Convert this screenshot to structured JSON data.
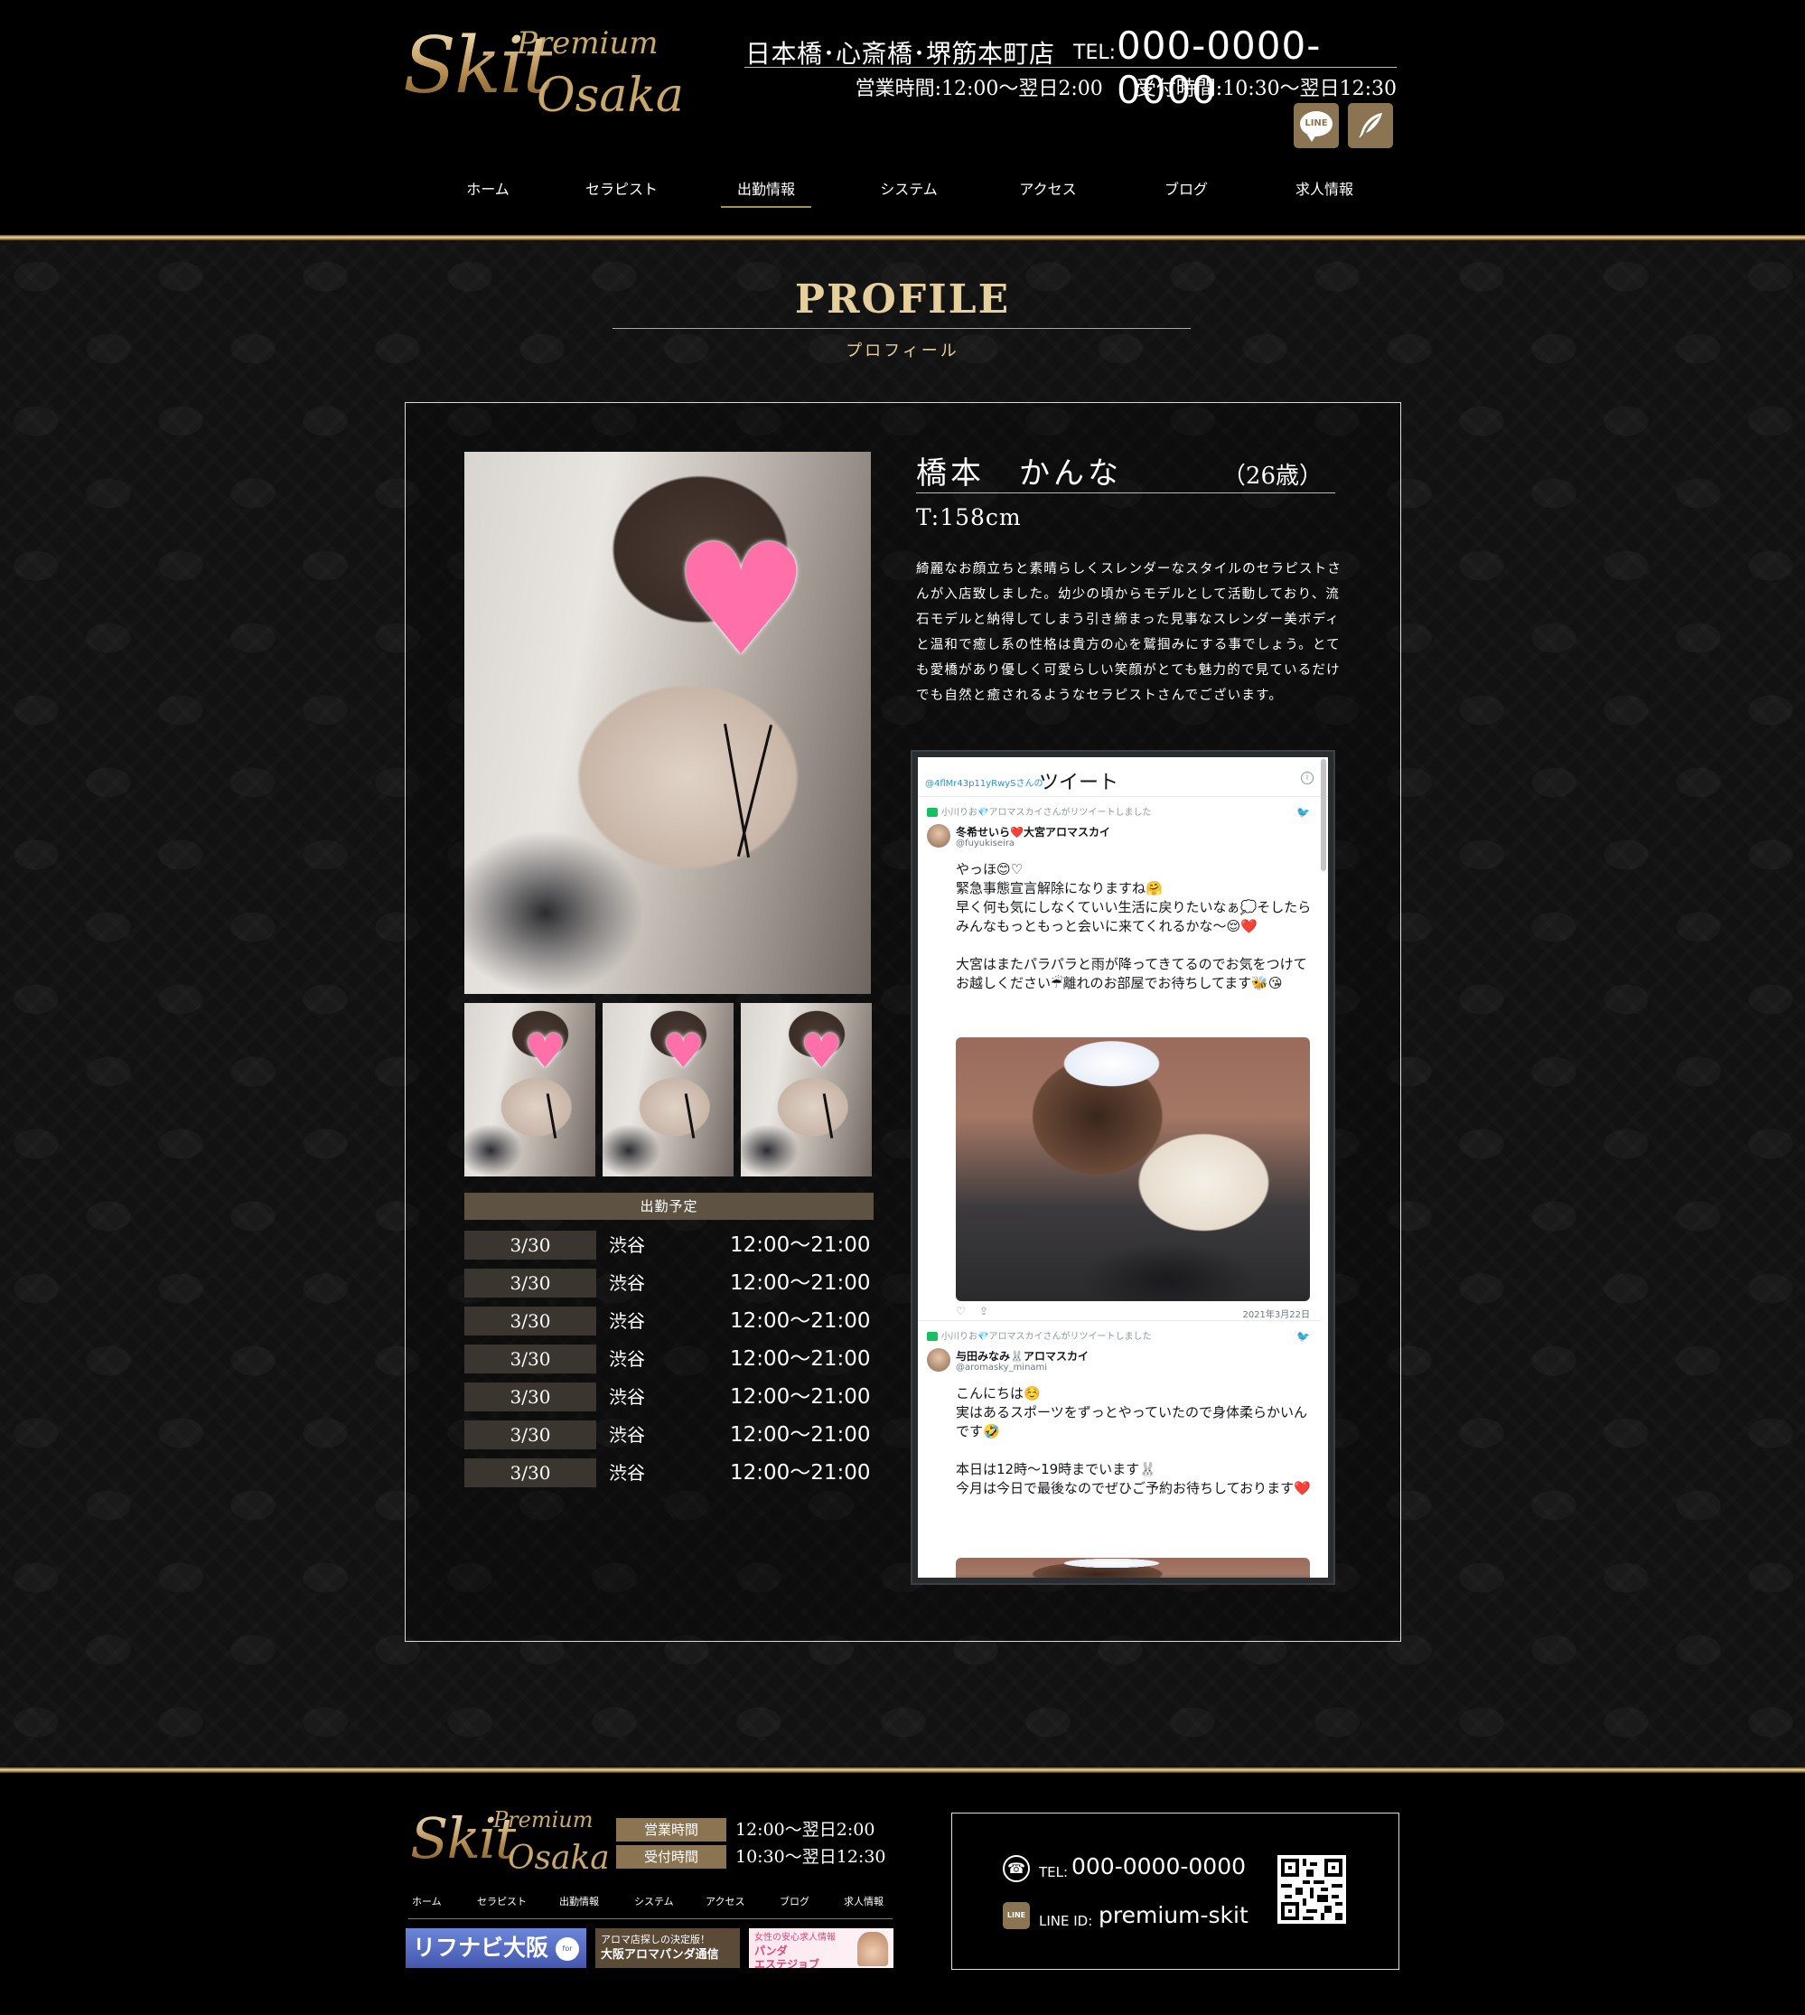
{
  "header": {
    "logo": {
      "big": "Skit",
      "premium": "Premium",
      "osaka": "Osaka"
    },
    "store_name": "日本橋･心斎橋･堺筋本町店",
    "tel_label": "TEL:",
    "tel": "000-0000-0000",
    "business_hours": "営業時間:12:00～翌日2:00",
    "reception_hours": "受付時間:10:30～翌日12:30",
    "sns": [
      {
        "icon": "line-icon",
        "label": "LINE"
      },
      {
        "icon": "feather-icon"
      }
    ]
  },
  "nav": {
    "items": [
      "ホーム",
      "セラピスト",
      "出勤情報",
      "システム",
      "アクセス",
      "ブログ",
      "求人情報"
    ],
    "active_index": 2
  },
  "page": {
    "title": "PROFILE",
    "subtitle": "プロフィール"
  },
  "profile": {
    "name": "橋本　かんな",
    "age": "（26歳）",
    "height": "T:158cm",
    "description": "綺麗なお顔立ちと素晴らしくスレンダーなスタイルのセラピストさんが入店致しました。幼少の頃からモデルとして活動しており、流石モデルと納得してしまう引き締まった見事なスレンダー美ボディと温和で癒し系の性格は貴方の心を鷲掴みにする事でしょう。とても愛橋があり優しく可愛らしい笑顔がとても魅力的で見ているだけでも自然と癒されるようなセラピストさんでございます。"
  },
  "schedule": {
    "header": "出勤予定",
    "rows": [
      {
        "date": "3/30",
        "area": "渋谷",
        "time": "12:00～21:00"
      },
      {
        "date": "3/30",
        "area": "渋谷",
        "time": "12:00～21:00"
      },
      {
        "date": "3/30",
        "area": "渋谷",
        "time": "12:00～21:00"
      },
      {
        "date": "3/30",
        "area": "渋谷",
        "time": "12:00～21:00"
      },
      {
        "date": "3/30",
        "area": "渋谷",
        "time": "12:00～21:00"
      },
      {
        "date": "3/30",
        "area": "渋谷",
        "time": "12:00～21:00"
      },
      {
        "date": "3/30",
        "area": "渋谷",
        "time": "12:00～21:00"
      }
    ]
  },
  "twitter": {
    "handle": "@4flMr43p11yRwySさんの",
    "title": "ツイート",
    "tweets": [
      {
        "retweeted_by": "小川りお💎アロマスカイさんがリツイートしました",
        "author": "冬希せいら❤️大宮アロマスカイ",
        "username": "@fuyukiseira",
        "text": "やっほ😊♡\n緊急事態宣言解除になりますね🤗\n早く何も気にしなくていい生活に戻りたいなぁ💭そしたらみんなもっともっと会いに来てくれるかな〜😌❤️\n\n大宮はまたパラパラと雨が降ってきてるのでお気をつけてお越しください☔離れのお部屋でお待ちしてます🐝😘",
        "date": "2021年3月22日"
      },
      {
        "retweeted_by": "小川りお💎アロマスカイさんがリツイートしました",
        "author": "与田みなみ🐰アロマスカイ",
        "username": "@aromasky_minami",
        "text": "こんにちは☺️\n実はあるスポーツをずっとやっていたので身体柔らかいんです🤣\n\n本日は12時〜19時までいます🐰\n今月は今日で最後なのでぜひご予約お待ちしております❤️"
      }
    ]
  },
  "footer": {
    "logo": {
      "big": "Skit",
      "premium": "Premium",
      "osaka": "Osaka"
    },
    "hours": [
      {
        "label": "営業時間",
        "value": "12:00～翌日2:00"
      },
      {
        "label": "受付時間",
        "value": "10:30～翌日12:30"
      }
    ],
    "nav": [
      "ホーム",
      "セラピスト",
      "出勤情報",
      "システム",
      "アクセス",
      "ブログ",
      "求人情報"
    ],
    "banners": [
      {
        "text": "リフナビ大阪",
        "badge": "for MEN"
      },
      {
        "line1": "アロマ店探しの決定版！",
        "line2": "大阪アロマパンダ通信"
      },
      {
        "line1": "女性の安心求人情報",
        "line2": "パンダ",
        "line3": "エステジョブ"
      }
    ],
    "contact": {
      "tel_label": "TEL:",
      "tel": "000-0000-0000",
      "line_label": "LINE ID:",
      "line_id": "premium-skit",
      "line_icon_text": "LINE"
    }
  }
}
